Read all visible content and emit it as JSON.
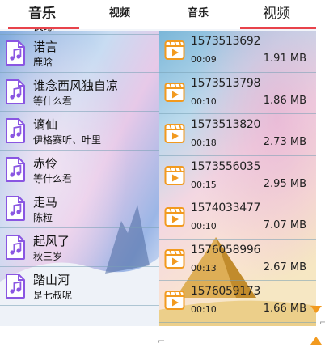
{
  "left": {
    "tabs": [
      {
        "label": "音乐",
        "active": true
      },
      {
        "label": "视频",
        "active": false
      }
    ],
    "partial_song": "良缘",
    "songs": [
      {
        "title": "诺言",
        "artist": "鹿晗"
      },
      {
        "title": "谁念西风独自凉",
        "artist": "等什么君"
      },
      {
        "title": "谪仙",
        "artist": "伊格赛听、叶里"
      },
      {
        "title": "赤伶",
        "artist": "等什么君"
      },
      {
        "title": "走马",
        "artist": "陈粒"
      },
      {
        "title": "起风了",
        "artist": "秋三岁"
      },
      {
        "title": "踏山河",
        "artist": "是七叔呢"
      }
    ]
  },
  "right": {
    "tabs": [
      {
        "label": "音乐",
        "active": false
      },
      {
        "label": "视频",
        "active": true
      }
    ],
    "videos": [
      {
        "name": "1573513692",
        "duration": "00:09",
        "size": "1.91 MB"
      },
      {
        "name": "1573513798",
        "duration": "00:10",
        "size": "1.86 MB"
      },
      {
        "name": "1573513820",
        "duration": "00:18",
        "size": "2.73 MB"
      },
      {
        "name": "1573556035",
        "duration": "00:15",
        "size": "2.95 MB"
      },
      {
        "name": "1574033477",
        "duration": "00:10",
        "size": "7.07 MB"
      },
      {
        "name": "1576058996",
        "duration": "00:13",
        "size": "2.67 MB"
      },
      {
        "name": "1576059173",
        "duration": "00:10",
        "size": "1.66 MB"
      }
    ]
  },
  "colors": {
    "accent": "#e8434b",
    "music_icon": "#8a56e2",
    "video_icon": "#f29a1f",
    "handle": "#f29a1f"
  },
  "icons": {
    "music_file": "music-file-icon",
    "video_file": "video-file-icon",
    "handle": "handle-icon"
  }
}
